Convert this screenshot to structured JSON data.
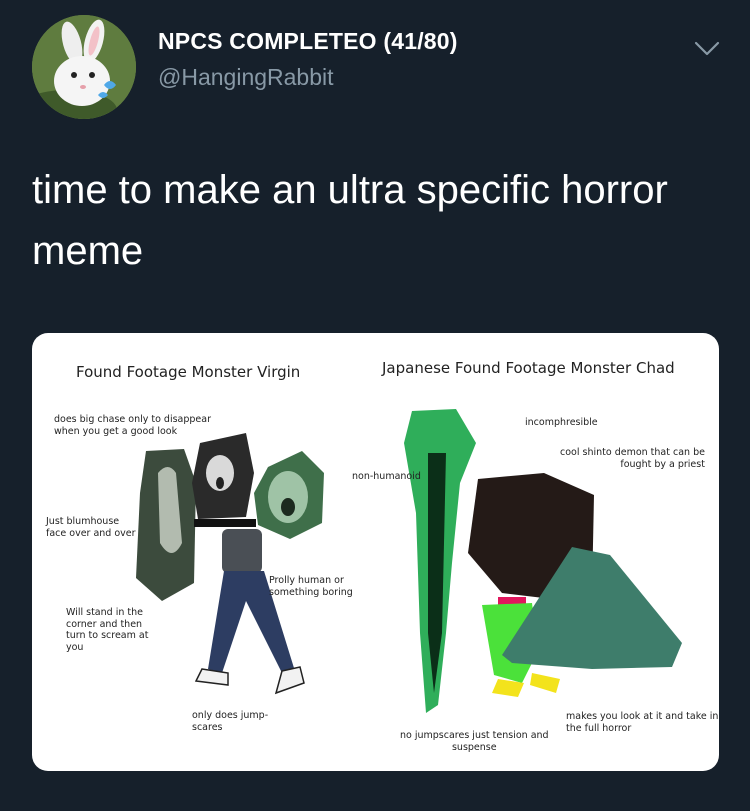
{
  "author": {
    "display_name": "NPCS COMPLETEO (41/80)",
    "handle": "@HangingRabbit",
    "avatar_icon": "white-rabbit-avatar"
  },
  "menu": {
    "icon": "chevron-down-icon"
  },
  "tweet": {
    "text_line1": "time to make an ultra specific horror",
    "text_line2": "meme"
  },
  "meme": {
    "left_title": "Found Footage Monster Virgin",
    "right_title": "Japanese Found Footage Monster Chad",
    "left_labels": {
      "chase_1": "does big chase only to disappear",
      "chase_2": "when you get a good look",
      "blum_1": "Just blumhouse",
      "blum_2": "face over and over",
      "corner_1": "Will stand in the",
      "corner_2": "corner and then",
      "corner_3": "turn to scream at",
      "corner_4": "you",
      "human_1": "Prolly human or",
      "human_2": "something boring",
      "jump_1": "only does jump-",
      "jump_2": "scares"
    },
    "right_labels": {
      "incomp": "incomphresible",
      "shinto_1": "cool shinto demon that can be",
      "shinto_2": "fought by a priest",
      "nonhuman": "non-humanoid",
      "tension_1": "no jumpscares just tension and",
      "tension_2": "suspense",
      "look_1": "makes you look at it and take in",
      "look_2": "the full horror"
    }
  },
  "colors": {
    "background": "#16202b",
    "secondary_text": "#8899a6",
    "accent_green": "#2fae5a"
  }
}
